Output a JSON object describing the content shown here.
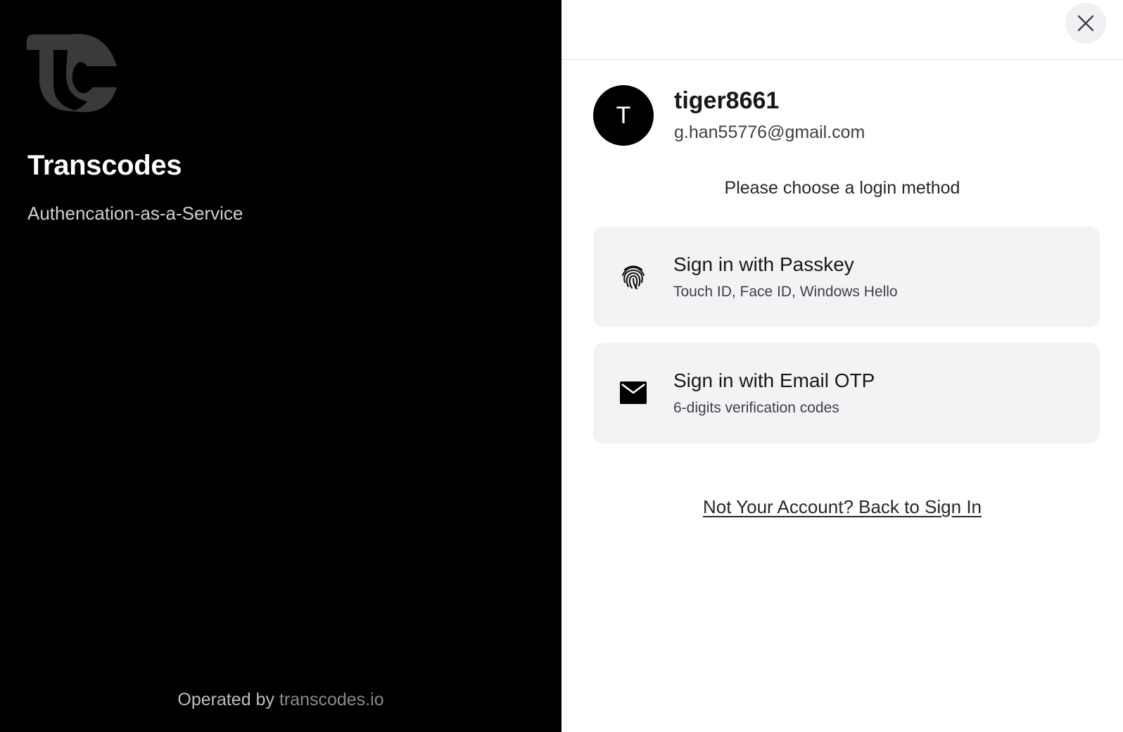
{
  "brand": {
    "title": "Transcodes",
    "subtitle": "Authencation-as-a-Service",
    "footer_prefix": "Operated by",
    "footer_link": "transcodes.io"
  },
  "header": {
    "close_icon": "close-icon"
  },
  "user": {
    "avatar_initial": "T",
    "username": "tiger8661",
    "email": "g.han55776@gmail.com"
  },
  "login": {
    "prompt": "Please choose a login method",
    "methods": [
      {
        "title": "Sign in with Passkey",
        "description": "Touch ID, Face ID, Windows Hello",
        "icon": "fingerprint-icon"
      },
      {
        "title": "Sign in with Email OTP",
        "description": "6-digits verification codes",
        "icon": "mail-icon"
      }
    ],
    "back_link": "Not Your Account? Back to Sign In"
  },
  "colors": {
    "brand_panel_bg": "#000000",
    "card_bg": "#f3f3f6",
    "avatar_bg": "#000000",
    "logo": "#3a3a3a"
  }
}
